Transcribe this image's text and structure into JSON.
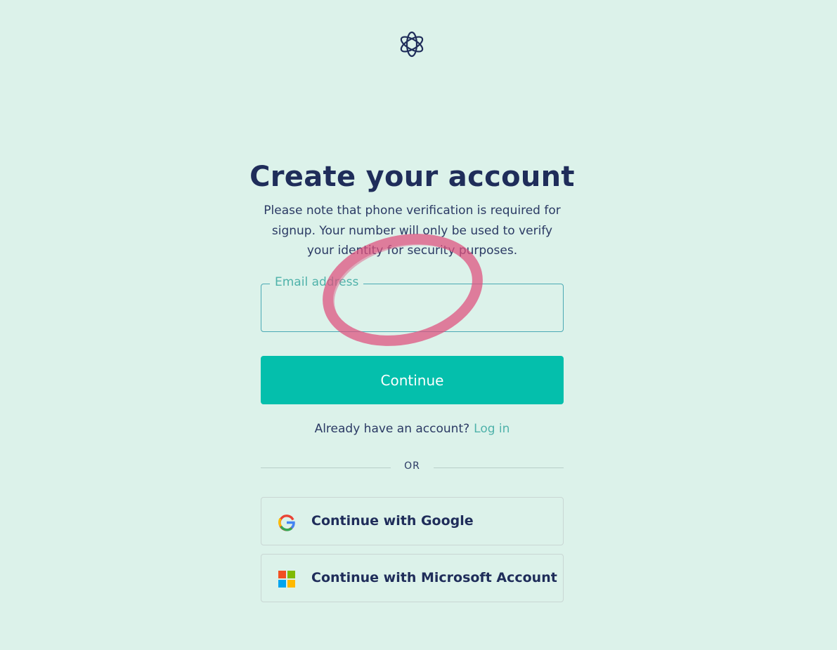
{
  "header": {
    "logo_icon": "openai-logo-icon"
  },
  "signup": {
    "title": "Create your account",
    "subtitle": "Please note that phone verification is required for signup. Your number will only be used to verify your identity for security purposes.",
    "email_label": "Email address",
    "email_value": "",
    "continue_label": "Continue",
    "login_prompt": "Already have an account?",
    "login_link": "Log in",
    "divider_text": "OR"
  },
  "social": {
    "google_label": "Continue with Google",
    "google_icon": "google-icon",
    "microsoft_label": "Continue with Microsoft Account",
    "microsoft_icon": "microsoft-icon"
  },
  "colors": {
    "background": "#dcf2ea",
    "primary": "#04bfac",
    "text": "#1f2d5a",
    "accent": "#4fb2aa",
    "annotation": "#e0507e"
  }
}
